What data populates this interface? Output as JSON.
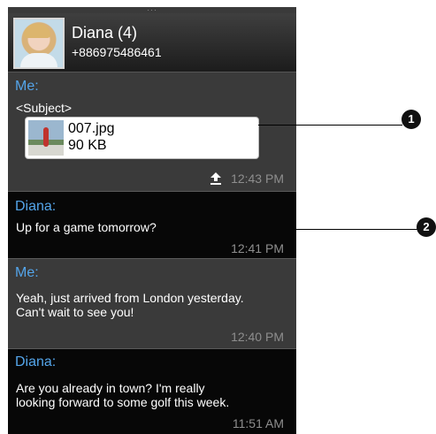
{
  "contact": {
    "name": "Diana (4)",
    "phone": "+886975486461"
  },
  "messages": [
    {
      "sender": "Me:",
      "subject": "<Subject>",
      "attachment": {
        "filename": "007.jpg",
        "size": "90 KB"
      },
      "time": "12:43 PM",
      "status_icon": "upload-icon"
    },
    {
      "sender": "Diana:",
      "text": "Up for a game tomorrow?",
      "time": "12:41 PM"
    },
    {
      "sender": "Me:",
      "text_lines": [
        "Yeah, just arrived from London yesterday.",
        "Can't wait to see you!"
      ],
      "time": "12:40 PM"
    },
    {
      "sender": "Diana:",
      "text_lines": [
        "Are you already in town? I'm really",
        "looking forward to some golf this week."
      ],
      "time": "11:51 AM"
    }
  ],
  "callouts": [
    "1",
    "2"
  ],
  "colors": {
    "sender_blue": "#54a5ea",
    "me_bubble": "#3a3a3a",
    "them_bubble": "#070707",
    "time_gray": "#8e8e8e"
  }
}
